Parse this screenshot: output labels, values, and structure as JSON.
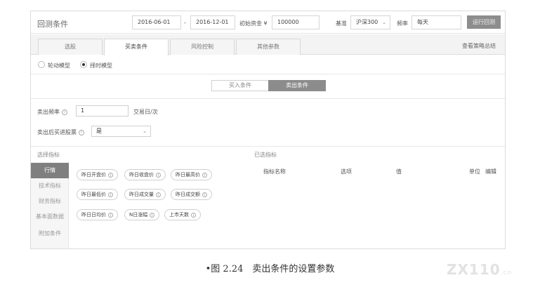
{
  "header": {
    "title": "回测条件",
    "start_date": "2016-06-01",
    "date_sep": "-",
    "end_date": "2016-12-01",
    "capital_label": "初始资金 ¥",
    "capital_value": "100000",
    "benchmark_label": "基准",
    "benchmark_value": "沪深300",
    "frequency_label": "频率",
    "frequency_value": "每天",
    "run_button": "运行回测"
  },
  "tabs": [
    "选股",
    "买卖条件",
    "风险控制",
    "其他参数"
  ],
  "active_tab": "买卖条件",
  "strategy_link": "查看策略总结",
  "modes": [
    {
      "label": "轮动模型",
      "selected": false
    },
    {
      "label": "择时模型",
      "selected": true
    }
  ],
  "segments": {
    "buy": "买入条件",
    "sell": "卖出条件",
    "active": "卖出条件"
  },
  "form": {
    "sell_freq_label": "卖出频率",
    "sell_freq_value": "1",
    "sell_freq_unit": "交易日/次",
    "sell_after_buy_label": "卖出后买进股票",
    "sell_after_buy_value": "是"
  },
  "sections": {
    "candidates": "选择指标",
    "selected": "已选指标"
  },
  "categories": [
    "行情",
    "技术指标",
    "财务指标",
    "基本面数据",
    "附加条件"
  ],
  "active_category": "行情",
  "indicators": [
    [
      "昨日开盘价",
      "昨日收盘价",
      "昨日最高价"
    ],
    [
      "昨日最低价",
      "昨日成交量",
      "昨日成交额"
    ],
    [
      "昨日日均价",
      "N日涨幅",
      "上市天数"
    ]
  ],
  "selected_columns": [
    "指标名称",
    "选项",
    "值",
    "单位",
    "编辑"
  ],
  "caption": "•图 2.24　卖出条件的设置参数",
  "watermark": "ZX110",
  "watermark_suffix": ".cn"
}
